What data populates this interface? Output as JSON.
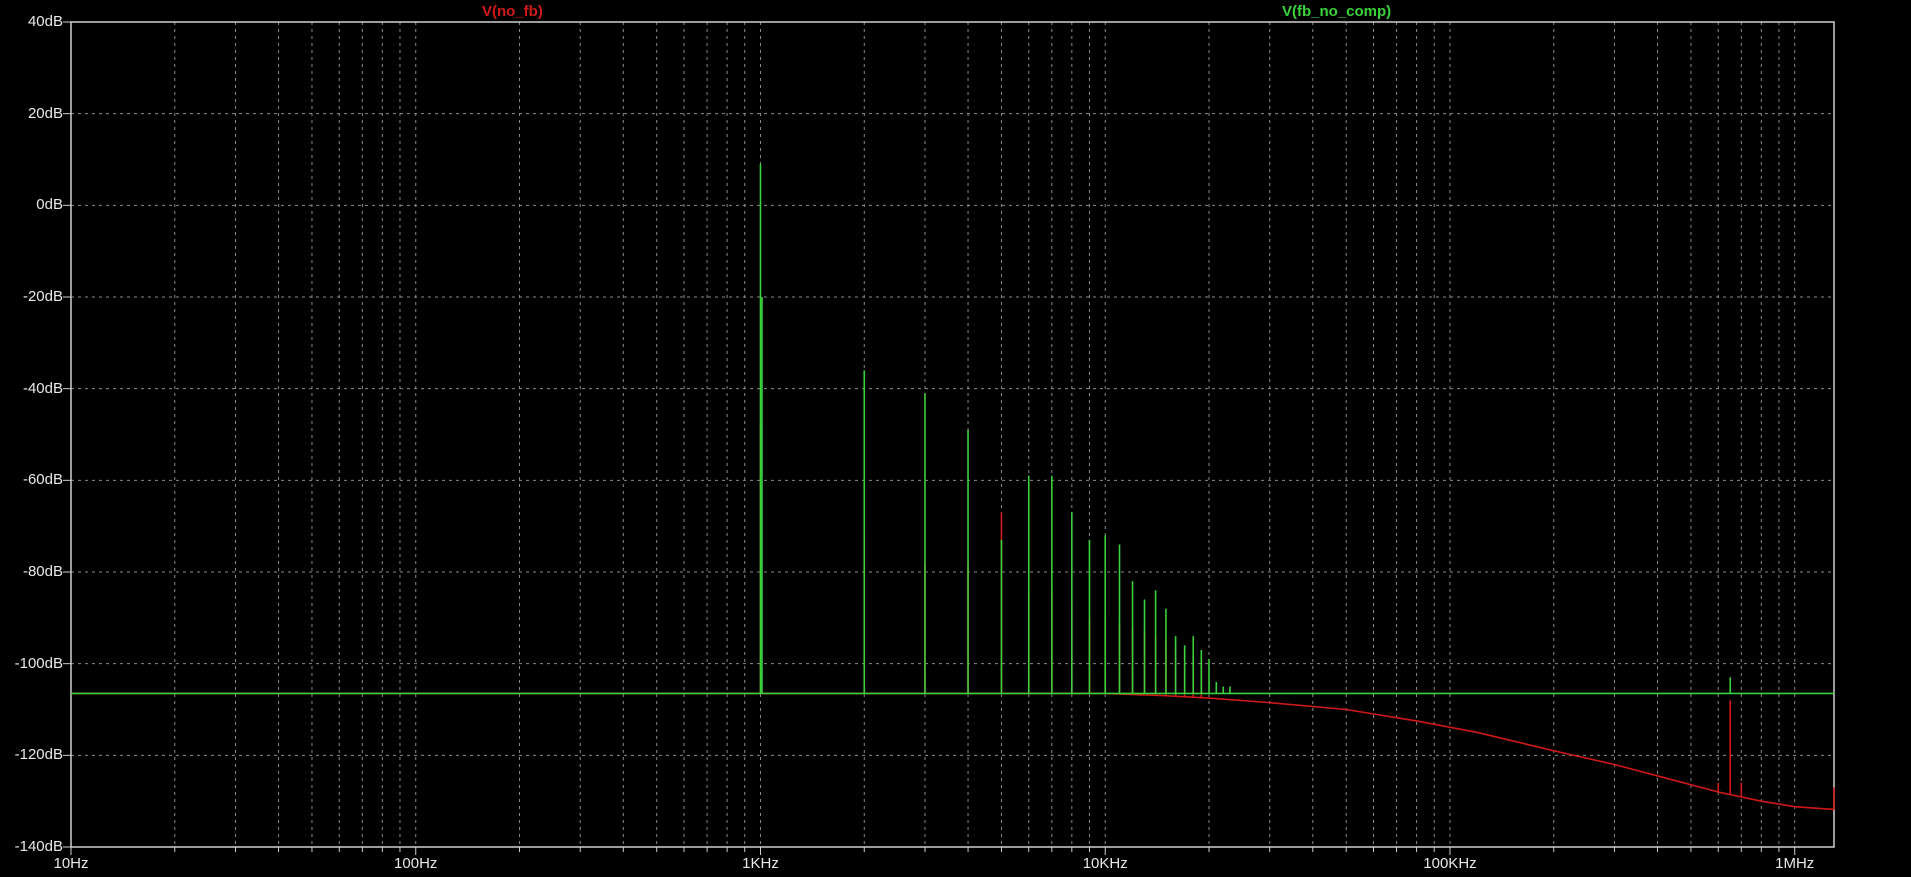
{
  "chart_data": {
    "type": "line",
    "x_scale": "log",
    "xlim": [
      10,
      1300000
    ],
    "ylim": [
      -140,
      40
    ],
    "x_ticks": [
      {
        "value": 10,
        "label": "10Hz"
      },
      {
        "value": 100,
        "label": "100Hz"
      },
      {
        "value": 1000,
        "label": "1KHz"
      },
      {
        "value": 10000,
        "label": "10KHz"
      },
      {
        "value": 100000,
        "label": "100KHz"
      },
      {
        "value": 1000000,
        "label": "1MHz"
      }
    ],
    "y_ticks": [
      {
        "value": 40,
        "label": "40dB"
      },
      {
        "value": 20,
        "label": "20dB"
      },
      {
        "value": 0,
        "label": "0dB"
      },
      {
        "value": -20,
        "label": "-20dB"
      },
      {
        "value": -40,
        "label": "-40dB"
      },
      {
        "value": -60,
        "label": "-60dB"
      },
      {
        "value": -80,
        "label": "-80dB"
      },
      {
        "value": -100,
        "label": "-100dB"
      },
      {
        "value": -120,
        "label": "-120dB"
      },
      {
        "value": -140,
        "label": "-140dB"
      }
    ],
    "grid": true,
    "background": "#000000",
    "series": [
      {
        "name": "V(no_fb)",
        "color": "#d01818",
        "floor": [
          [
            10,
            -106.5
          ],
          [
            10000,
            -106.5
          ],
          [
            15000,
            -107
          ],
          [
            20000,
            -107.5
          ],
          [
            30000,
            -108.5
          ],
          [
            50000,
            -110
          ],
          [
            80000,
            -112.5
          ],
          [
            120000,
            -115
          ],
          [
            200000,
            -119
          ],
          [
            300000,
            -122
          ],
          [
            450000,
            -125.5
          ],
          [
            600000,
            -128
          ],
          [
            800000,
            -130
          ],
          [
            1000000,
            -131.2
          ],
          [
            1300000,
            -131.8
          ]
        ],
        "spikes": [
          [
            1000,
            -48
          ],
          [
            2000,
            -71
          ],
          [
            3000,
            -78
          ],
          [
            4000,
            -78
          ],
          [
            5000,
            -67
          ],
          [
            6000,
            -84
          ],
          [
            7000,
            -84
          ],
          [
            8000,
            -87
          ],
          [
            9000,
            -90
          ],
          [
            10000,
            -90
          ],
          [
            11000,
            -91
          ],
          [
            12000,
            -92
          ],
          [
            13000,
            -93
          ],
          [
            14000,
            -94
          ],
          [
            15000,
            -95
          ],
          [
            16000,
            -96
          ],
          [
            17000,
            -97
          ],
          [
            18000,
            -98
          ],
          [
            19000,
            -99
          ],
          [
            600000,
            -126
          ],
          [
            650000,
            -108
          ],
          [
            700000,
            -126
          ],
          [
            1300000,
            -127
          ]
        ]
      },
      {
        "name": "V(fb_no_comp)",
        "color": "#3ad23a",
        "floor": [
          [
            10,
            -106.5
          ],
          [
            1300000,
            -106.5
          ]
        ],
        "spikes": [
          [
            1000,
            9
          ],
          [
            1010,
            -20
          ],
          [
            2000,
            -36
          ],
          [
            3000,
            -41
          ],
          [
            4000,
            -49
          ],
          [
            5000,
            -73
          ],
          [
            6000,
            -59
          ],
          [
            7000,
            -59
          ],
          [
            8000,
            -67
          ],
          [
            9000,
            -73
          ],
          [
            10000,
            -72
          ],
          [
            11000,
            -74
          ],
          [
            12000,
            -82
          ],
          [
            13000,
            -86
          ],
          [
            14000,
            -84
          ],
          [
            15000,
            -88
          ],
          [
            16000,
            -94
          ],
          [
            17000,
            -96
          ],
          [
            18000,
            -94
          ],
          [
            19000,
            -97
          ],
          [
            20000,
            -99
          ],
          [
            21000,
            -104
          ],
          [
            22000,
            -105
          ],
          [
            23000,
            -105
          ],
          [
            650000,
            -103
          ]
        ]
      }
    ]
  }
}
